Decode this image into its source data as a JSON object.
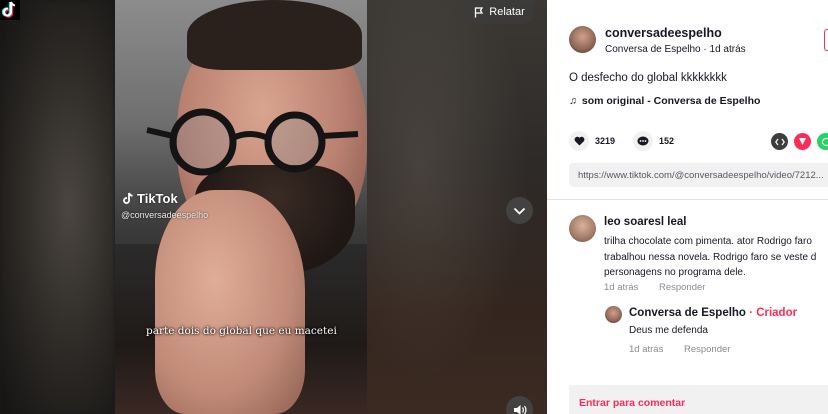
{
  "video": {
    "watermark_brand": "TikTok",
    "watermark_handle": "@conversadeespelho",
    "subtitle": "parte dois do global que eu macetei",
    "report_label": "Relatar"
  },
  "author": {
    "username": "conversadeespelho",
    "display_name": "Conversa de Espelho",
    "separator": "·",
    "posted": "1d atrás"
  },
  "post": {
    "caption": "O desfecho do global kkkkkkkk",
    "music_icon": "♫",
    "music": "som original - Conversa de Espelho",
    "likes": "3219",
    "comments": "152",
    "link": "https://www.tiktok.com/@conversadeespelho/video/7212..."
  },
  "share_icons": [
    {
      "name": "embed-icon",
      "color": "#3d3d3d"
    },
    {
      "name": "send-icon",
      "color": "#fe2c55"
    },
    {
      "name": "whatsapp-icon",
      "color": "#25d366"
    }
  ],
  "comments": [
    {
      "name": "leo soaresl leal",
      "lines": [
        "trilha chocolate com pimenta. ator Rodrigo faro",
        "trabalhou nessa novela. Rodrigo faro se veste d",
        "personagens no programa dele."
      ],
      "time": "1d atrás",
      "reply_label": "Responder",
      "replies": [
        {
          "name": "Conversa de Espelho",
          "creator_badge": " · Criador",
          "text": "Deus me defenda",
          "time": "1d atrás",
          "reply_label": "Responder"
        }
      ]
    }
  ],
  "comment_bar": {
    "label": "Entrar para comentar"
  },
  "colors": {
    "accent": "#fe2c55",
    "muted": "#8a8b91",
    "panel_bg": "#ffffff"
  }
}
